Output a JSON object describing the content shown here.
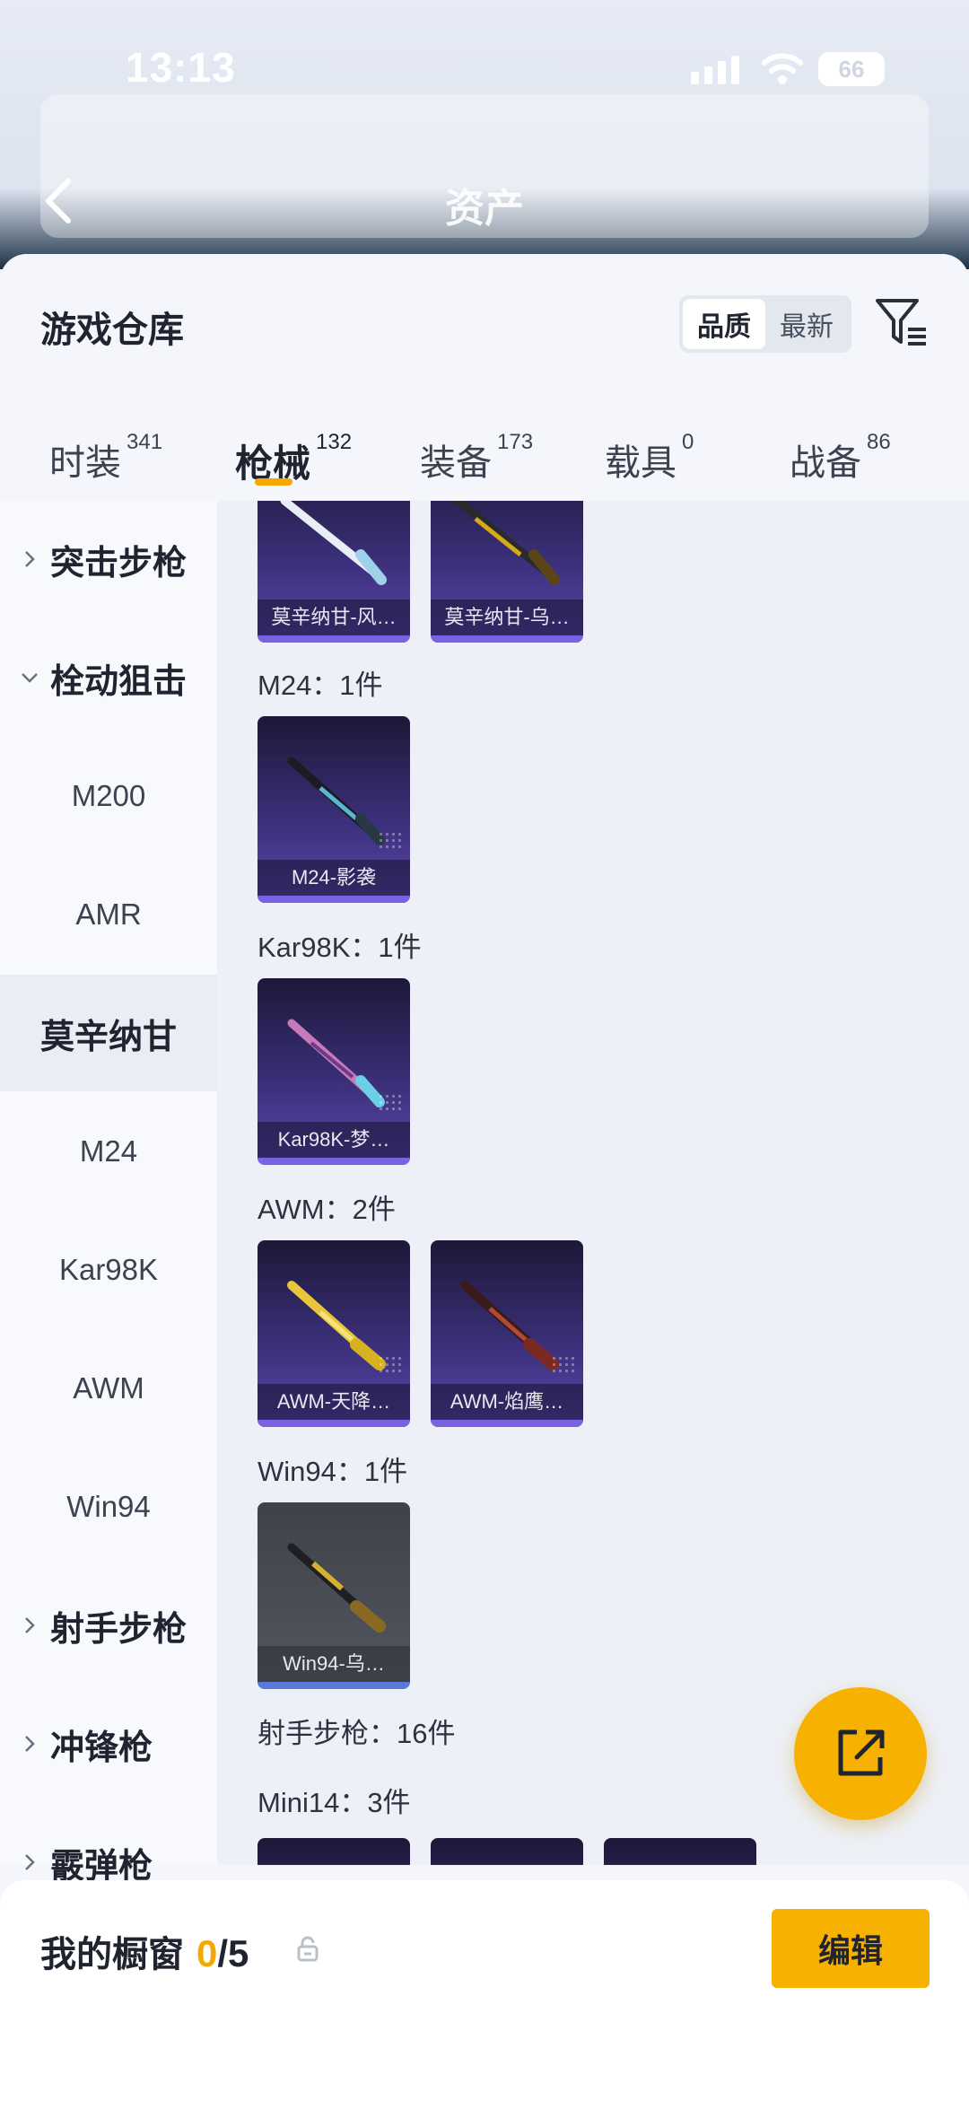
{
  "status_bar": {
    "time": "13:13",
    "battery": "66"
  },
  "header": {
    "title": "资产"
  },
  "panel": {
    "title": "游戏仓库",
    "sort_options": [
      "品质",
      "最新"
    ],
    "sort_selected": "品质"
  },
  "tabs": [
    {
      "label": "时装",
      "count": "341"
    },
    {
      "label": "枪械",
      "count": "132"
    },
    {
      "label": "装备",
      "count": "173"
    },
    {
      "label": "载具",
      "count": "0"
    },
    {
      "label": "战备",
      "count": "86"
    }
  ],
  "active_tab": "枪械",
  "sidebar": {
    "groups": [
      {
        "label": "突击步枪"
      },
      {
        "label": "栓动狙击"
      },
      {
        "label": "射手步枪"
      },
      {
        "label": "冲锋枪"
      },
      {
        "label": "霰弹枪"
      }
    ],
    "subitems": [
      "M200",
      "AMR",
      "莫辛纳甘",
      "M24",
      "Kar98K",
      "AWM",
      "Win94"
    ],
    "selected": "莫辛纳甘"
  },
  "content": {
    "top_cards": [
      "莫辛纳甘-风…",
      "莫辛纳甘-乌…"
    ],
    "sections": [
      {
        "label": "M24：1件",
        "cards": [
          "M24-影袭"
        ]
      },
      {
        "label": "Kar98K：1件",
        "cards": [
          "Kar98K-梦…"
        ]
      },
      {
        "label": "AWM：2件",
        "cards": [
          "AWM-天降…",
          "AWM-焰鹰…"
        ]
      },
      {
        "label": "Win94：1件",
        "cards": [
          "Win94-乌…"
        ]
      }
    ],
    "dmr_total": "射手步枪：16件",
    "mini14_label": "Mini14：3件"
  },
  "bottom": {
    "showcase_label": "我的橱窗",
    "showcase_count": "0",
    "showcase_max": "/5",
    "edit_label": "编辑"
  },
  "colors": {
    "accent": "#f7b100",
    "card_purple": "#3a2f78",
    "card_gray": "#4b4e56"
  }
}
